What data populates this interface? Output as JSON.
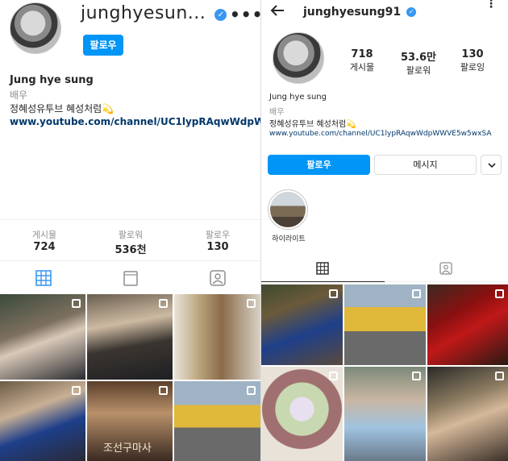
{
  "left": {
    "username": "junghyesun...",
    "follow_button": "팔로우",
    "more_icon": "more-horizontal-icon",
    "name": "Jung hye sung",
    "category": "배우",
    "bio": "정혜성유투브 혜성처럼💫",
    "link": "www.youtube.com/channel/UC1lypRAqwWdpW...",
    "stats": [
      {
        "label": "게시물",
        "value": "724"
      },
      {
        "label": "팔로워",
        "value": "536천"
      },
      {
        "label": "팔로우",
        "value": "130"
      }
    ],
    "tabs": [
      "grid-icon",
      "reels-icon",
      "tagged-icon"
    ],
    "watermark": "조선구마사"
  },
  "right": {
    "back_icon": "back-arrow-icon",
    "username": "junghyesung91",
    "menu_icon": "kebab-menu-icon",
    "stats": [
      {
        "label": "게시물",
        "value": "718"
      },
      {
        "label": "팔로워",
        "value": "53.6만"
      },
      {
        "label": "팔로잉",
        "value": "130"
      }
    ],
    "name": "Jung hye sung",
    "category": "배우",
    "bio": "정혜성유투브 혜성처럼💫",
    "link": "www.youtube.com/channel/UC1lypRAqwWdpWWVE5w5wxSA",
    "follow_button": "팔로우",
    "message_button": "메시지",
    "highlight_label": "하이라이트",
    "tabs": [
      "grid-icon",
      "tagged-icon"
    ]
  },
  "colors": {
    "accent": "#0095f6",
    "verified": "#3897f0",
    "text": "#262626",
    "muted": "#8e8e8e"
  }
}
